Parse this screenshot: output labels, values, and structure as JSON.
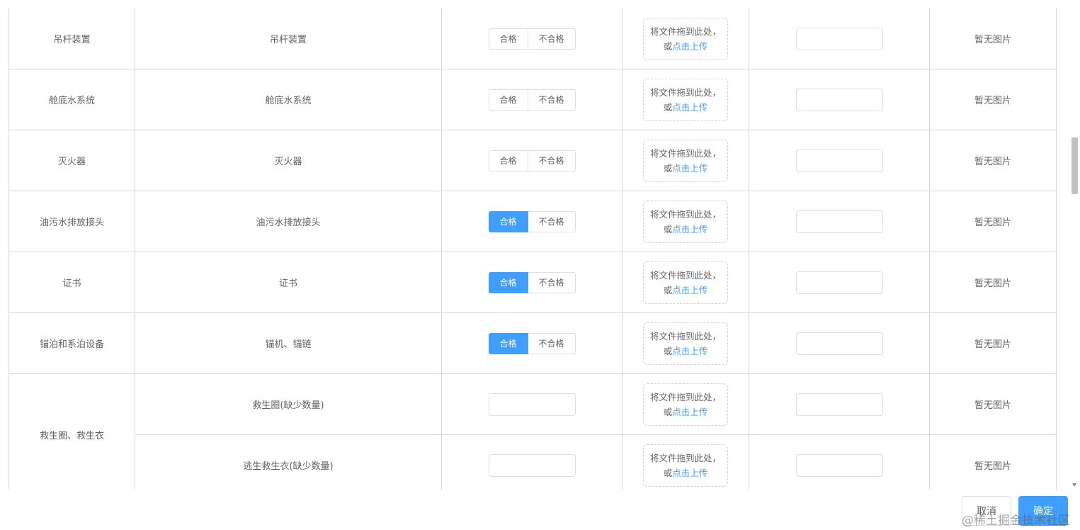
{
  "labels": {
    "pass": "合格",
    "fail": "不合格",
    "upload_hint": "将文件拖到此处，",
    "upload_or": "或",
    "upload_link": "点击上传",
    "no_image": "暂无图片"
  },
  "rows": [
    {
      "category": "吊杆装置",
      "item": "吊杆装置",
      "status": "none"
    },
    {
      "category": "舱底水系统",
      "item": "舱底水系统",
      "status": "none"
    },
    {
      "category": "灭火器",
      "item": "灭火器",
      "status": "none"
    },
    {
      "category": "油污水排放接头",
      "item": "油污水排放接头",
      "status": "pass"
    },
    {
      "category": "证书",
      "item": "证书",
      "status": "pass"
    },
    {
      "category": "锚泊和系泊设备",
      "item": "锚机、锚链",
      "status": "pass"
    }
  ],
  "group": {
    "category": "救生圈、救生衣",
    "items": [
      {
        "item": "救生圈(缺少数量)"
      },
      {
        "item": "逃生救生衣(缺少数量)"
      }
    ]
  },
  "footer": {
    "cancel": "取消",
    "confirm": "确定"
  },
  "watermark": "@稀土掘金技术社区",
  "colors": {
    "primary": "#409eff",
    "border": "#d4d7de",
    "text": "#606266"
  }
}
